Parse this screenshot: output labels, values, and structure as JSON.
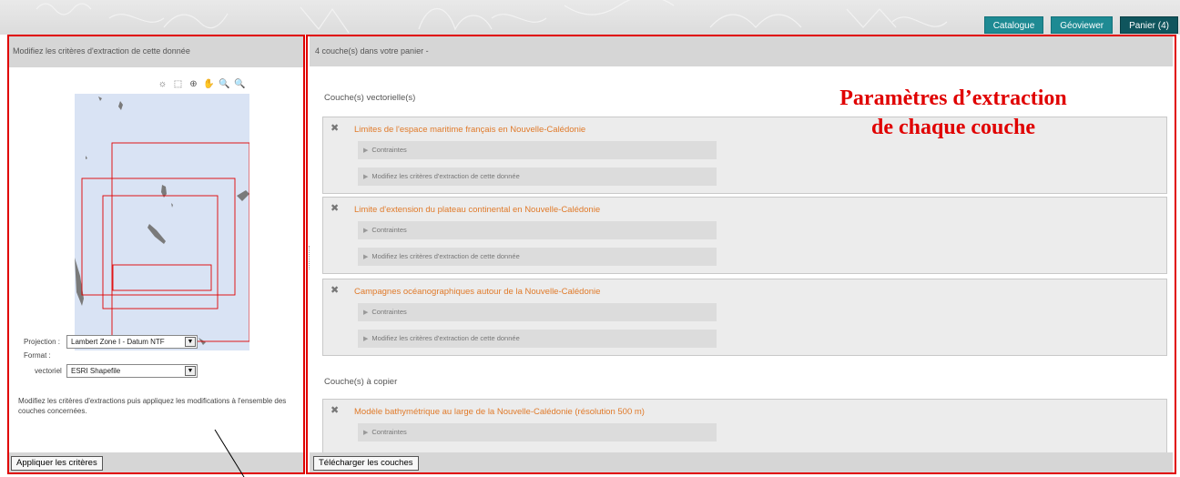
{
  "nav": {
    "tabs": [
      {
        "label": "Catalogue",
        "active": false
      },
      {
        "label": "Géoviewer",
        "active": false
      },
      {
        "label": "Panier (4)",
        "active": true
      }
    ]
  },
  "left_panel": {
    "header": "Modifiez les critères d'extraction de cette donnée",
    "toolbar_icons": [
      "sun-icon",
      "select-icon",
      "globe-icon",
      "pan-hand-icon",
      "zoom-in-icon",
      "zoom-out-icon"
    ],
    "projection_label": "Projection :",
    "projection_value": "Lambert Zone I - Datum NTF",
    "format_label": "Format :",
    "vector_label": "vectoriel",
    "vector_value": "ESRI Shapefile",
    "note": "Modifiez les critères d'extractions puis appliquez les modifications à l'ensemble des couches concernées.",
    "apply_button": "Appliquer les critères"
  },
  "right_panel": {
    "header": "4 couche(s) dans votre panier -",
    "vector_section": "Couche(s) vectorielle(s)",
    "copy_section": "Couche(s) à copier",
    "constraints_label": "Contraintes",
    "modify_label": "Modifiez les critères d'extraction de cette donnée",
    "layers": [
      {
        "title": "Limites de l'espace maritime français en Nouvelle-Calédonie"
      },
      {
        "title": "Limite d'extension du plateau continental en Nouvelle-Calédonie"
      },
      {
        "title": "Campagnes océanographiques autour de la Nouvelle-Calédonie"
      },
      {
        "title": "Modèle bathymétrique au large de la Nouvelle-Calédonie (résolution 500 m)"
      }
    ],
    "download_button": "Télécharger les couches"
  },
  "annotation": {
    "line1": "Paramètres d’extraction",
    "line2": "de chaque couche",
    "color": "#e00000"
  },
  "colors": {
    "accent": "#1e8a93",
    "active_tab": "#0f555d",
    "link_orange": "#e07a2a",
    "map_bg": "#d9e3f4"
  }
}
